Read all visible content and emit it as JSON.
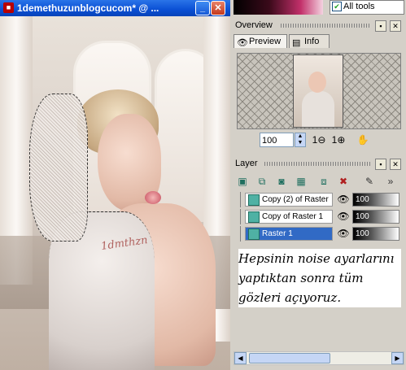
{
  "image_window": {
    "title": "1demethuzunblogcucom* @ ...",
    "tattoo": "1dmthzn"
  },
  "top": {
    "all_tools_label": "All tools",
    "all_tools_checked": true
  },
  "overview": {
    "title": "Overview",
    "tabs": [
      {
        "label": "Preview"
      },
      {
        "label": "Info"
      }
    ],
    "zoom": "100",
    "zoom_in_label": "1",
    "zoom_out_label": "1"
  },
  "layer": {
    "title": "Layer",
    "layers": [
      {
        "name": "Copy (2) of Raster",
        "opacity": "100"
      },
      {
        "name": "Copy of Raster 1",
        "opacity": "100"
      },
      {
        "name": "Raster 1",
        "opacity": "100"
      }
    ],
    "note": "Hepsinin noise ayarlarını yaptıktan sonra tüm gözleri açıyoruz."
  },
  "colors": {
    "title_bar": "#0a4fd4",
    "selection": "#316ac5",
    "layer_icon": "#4fb1a4"
  }
}
